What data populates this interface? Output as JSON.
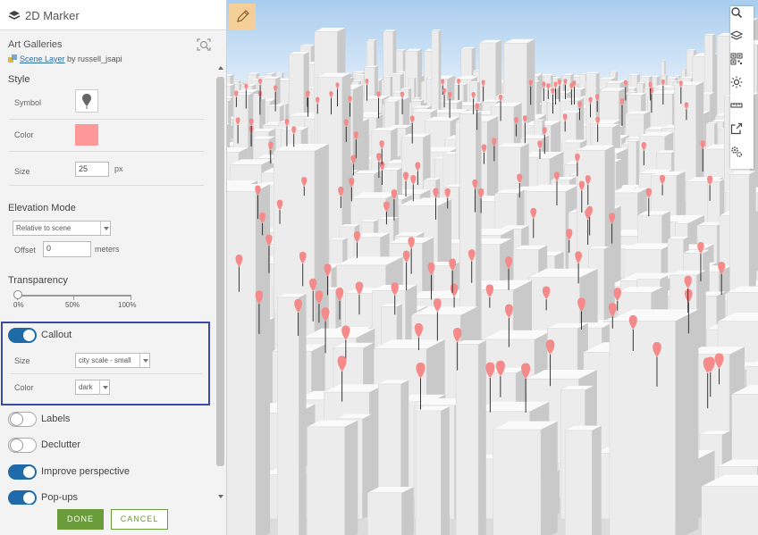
{
  "panel": {
    "title": "2D Marker",
    "layer_name": "Art Galleries",
    "layer_type": "Scene Layer",
    "layer_owner": " by russell_jsapi"
  },
  "style": {
    "title": "Style",
    "symbol_label": "Symbol",
    "color_label": "Color",
    "color": "#ff9999",
    "size_label": "Size",
    "size_value": "25",
    "size_unit": "px"
  },
  "elevation": {
    "title": "Elevation Mode",
    "mode": "Relative to scene",
    "offset_label": "Offset",
    "offset_value": "0",
    "offset_unit": "meters"
  },
  "transparency": {
    "title": "Transparency",
    "value_percent": 0,
    "ticks": [
      "0%",
      "50%",
      "100%"
    ]
  },
  "callout": {
    "label": "Callout",
    "enabled": true,
    "size_label": "Size",
    "size_value": "city scale - small",
    "color_label": "Color",
    "color_value": "dark",
    "highlight_color": "#3a4aa8"
  },
  "toggles": [
    {
      "label": "Labels",
      "on": false
    },
    {
      "label": "Declutter",
      "on": false
    },
    {
      "label": "Improve perspective",
      "on": true
    },
    {
      "label": "Pop-ups",
      "on": true
    }
  ],
  "footer": {
    "done": "DONE",
    "cancel": "CANCEL"
  },
  "map": {
    "tools": [
      "search-icon",
      "layers-icon",
      "qr-grid-icon",
      "sun-icon",
      "measure-icon",
      "share-icon",
      "settings-icon"
    ],
    "marker_color": "#f48a8a",
    "accent": "#f5cf9a"
  }
}
